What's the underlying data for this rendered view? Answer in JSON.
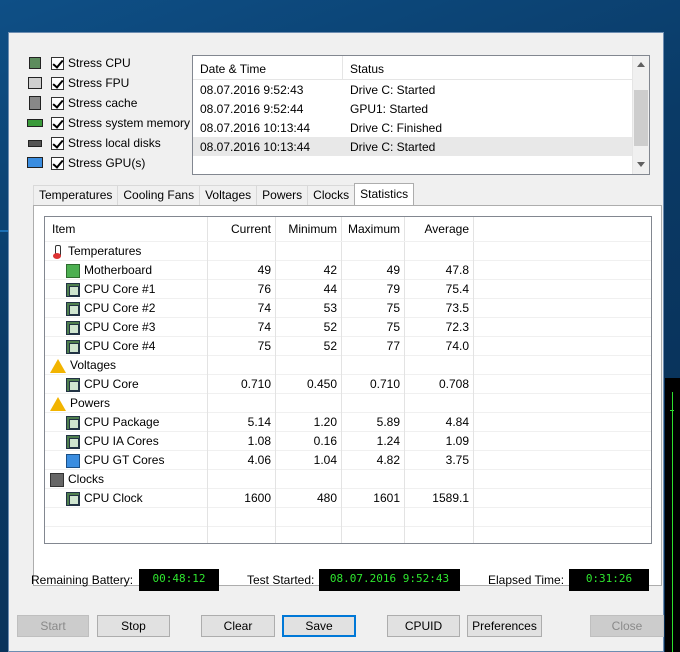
{
  "stress_options": [
    {
      "label": "Stress CPU",
      "icon": "cpu-chip-icon",
      "checked": true
    },
    {
      "label": "Stress FPU",
      "icon": "fpu-icon",
      "checked": true
    },
    {
      "label": "Stress cache",
      "icon": "cache-icon",
      "checked": true
    },
    {
      "label": "Stress system memory",
      "icon": "memory-icon",
      "checked": true
    },
    {
      "label": "Stress local disks",
      "icon": "disk-icon",
      "checked": true
    },
    {
      "label": "Stress GPU(s)",
      "icon": "gpu-monitor-icon",
      "checked": true
    }
  ],
  "log": {
    "headers": [
      "Date & Time",
      "Status"
    ],
    "rows": [
      {
        "time": "08.07.2016 9:52:43",
        "status": "Drive C: Started"
      },
      {
        "time": "08.07.2016 9:52:44",
        "status": "GPU1: Started"
      },
      {
        "time": "08.07.2016 10:13:44",
        "status": "Drive C: Finished"
      },
      {
        "time": "08.07.2016 10:13:44",
        "status": "Drive C: Started"
      }
    ]
  },
  "tabs": [
    "Temperatures",
    "Cooling Fans",
    "Voltages",
    "Powers",
    "Clocks",
    "Statistics"
  ],
  "active_tab": "Statistics",
  "stats": {
    "headers": [
      "Item",
      "Current",
      "Minimum",
      "Maximum",
      "Average"
    ],
    "rows": [
      {
        "kind": "group",
        "icon": "thermometer-icon",
        "label": "Temperatures"
      },
      {
        "kind": "item",
        "icon": "motherboard-icon",
        "label": "Motherboard",
        "current": "49",
        "minimum": "42",
        "maximum": "49",
        "average": "47.8"
      },
      {
        "kind": "item",
        "icon": "cpu-icon",
        "label": "CPU Core #1",
        "current": "76",
        "minimum": "44",
        "maximum": "79",
        "average": "75.4"
      },
      {
        "kind": "item",
        "icon": "cpu-icon",
        "label": "CPU Core #2",
        "current": "74",
        "minimum": "53",
        "maximum": "75",
        "average": "73.5"
      },
      {
        "kind": "item",
        "icon": "cpu-icon",
        "label": "CPU Core #3",
        "current": "74",
        "minimum": "52",
        "maximum": "75",
        "average": "72.3"
      },
      {
        "kind": "item",
        "icon": "cpu-icon",
        "label": "CPU Core #4",
        "current": "75",
        "minimum": "52",
        "maximum": "77",
        "average": "74.0"
      },
      {
        "kind": "group",
        "icon": "warning-icon",
        "label": "Voltages"
      },
      {
        "kind": "item",
        "icon": "cpu-icon",
        "label": "CPU Core",
        "current": "0.710",
        "minimum": "0.450",
        "maximum": "0.710",
        "average": "0.708"
      },
      {
        "kind": "group",
        "icon": "warning-icon",
        "label": "Powers"
      },
      {
        "kind": "item",
        "icon": "cpu-icon",
        "label": "CPU Package",
        "current": "5.14",
        "minimum": "1.20",
        "maximum": "5.89",
        "average": "4.84"
      },
      {
        "kind": "item",
        "icon": "cpu-icon",
        "label": "CPU IA Cores",
        "current": "1.08",
        "minimum": "0.16",
        "maximum": "1.24",
        "average": "1.09"
      },
      {
        "kind": "item",
        "icon": "monitor-icon",
        "label": "CPU GT Cores",
        "current": "4.06",
        "minimum": "1.04",
        "maximum": "4.82",
        "average": "3.75"
      },
      {
        "kind": "group",
        "icon": "clock-icon",
        "label": "Clocks"
      },
      {
        "kind": "item",
        "icon": "cpu-icon",
        "label": "CPU Clock",
        "current": "1600",
        "minimum": "480",
        "maximum": "1601",
        "average": "1589.1"
      }
    ]
  },
  "status_bar": {
    "battery_label": "Remaining Battery:",
    "battery_value": "00:48:12",
    "started_label": "Test Started:",
    "started_value": "08.07.2016 9:52:43",
    "elapsed_label": "Elapsed Time:",
    "elapsed_value": "0:31:26"
  },
  "buttons": {
    "start": "Start",
    "stop": "Stop",
    "clear": "Clear",
    "save": "Save",
    "cpuid": "CPUID",
    "preferences": "Preferences",
    "close": "Close"
  },
  "colors": {
    "lcd_text": "#2fe62f",
    "lcd_bg": "#000000",
    "window_bg": "#f0f0f0",
    "focus": "#0078d7"
  }
}
